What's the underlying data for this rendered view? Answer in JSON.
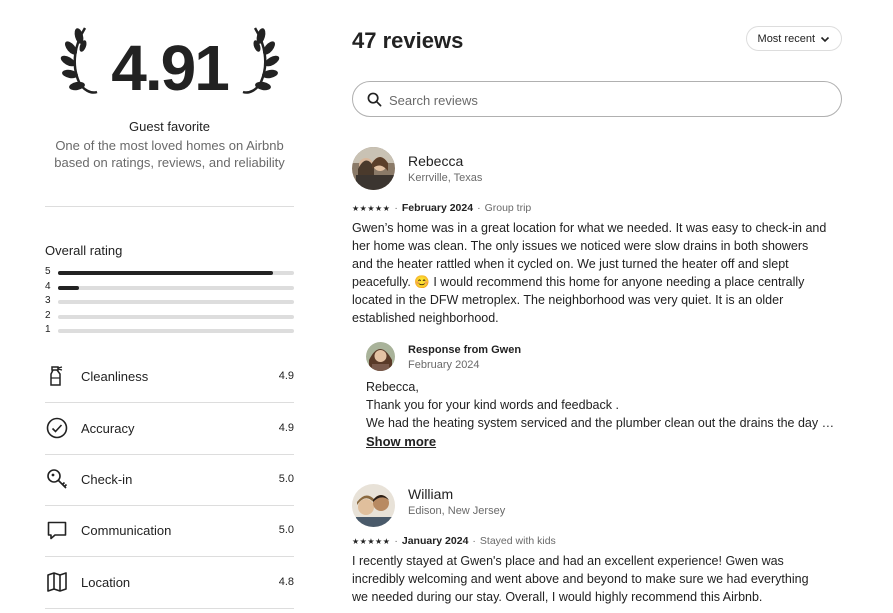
{
  "summary": {
    "rating": "4.91",
    "badge_title": "Guest favorite",
    "badge_subtitle": "One of the most loved homes on Airbnb based on ratings, reviews, and reliability"
  },
  "overall": {
    "title": "Overall rating",
    "bars": [
      {
        "label": "5",
        "fraction": 0.91
      },
      {
        "label": "4",
        "fraction": 0.09
      },
      {
        "label": "3",
        "fraction": 0
      },
      {
        "label": "2",
        "fraction": 0
      },
      {
        "label": "1",
        "fraction": 0
      }
    ]
  },
  "categories": [
    {
      "name": "Cleanliness",
      "value": "4.9",
      "icon": "spray-bottle-icon"
    },
    {
      "name": "Accuracy",
      "value": "4.9",
      "icon": "check-circle-icon"
    },
    {
      "name": "Check-in",
      "value": "5.0",
      "icon": "key-icon"
    },
    {
      "name": "Communication",
      "value": "5.0",
      "icon": "chat-bubble-icon"
    },
    {
      "name": "Location",
      "value": "4.8",
      "icon": "map-icon"
    }
  ],
  "reviews_header": {
    "count_label": "47 reviews",
    "sort_label": "Most recent"
  },
  "search": {
    "placeholder": "Search reviews"
  },
  "reviews": [
    {
      "name": "Rebecca",
      "location": "Kerrville, Texas",
      "stars": "★★★★★",
      "date": "February 2024",
      "trip": "Group trip",
      "lines": [
        "Gwen’s home was in a great location for what we needed. It was easy to check-in and",
        "her home was clean. The only issues we noticed were slow drains in both showers",
        "and the heater rattled when it cycled on. We just turned the heater off and slept",
        "peacefully. 😊 I would recommend this home for anyone needing a place centrally",
        "located in the DFW metroplex. The neighborhood was very quiet. It is an older",
        "established neighborhood."
      ],
      "response": {
        "title": "Response from Gwen",
        "date": "February 2024",
        "lines": [
          "Rebecca,",
          "Thank you for your kind words and feedback .",
          "We had the heating system serviced and the plumber clean out the drains the day after your stay."
        ],
        "show_more": "Show more"
      }
    },
    {
      "name": "William",
      "location": "Edison, New Jersey",
      "stars": "★★★★★",
      "date": "January 2024",
      "trip": "Stayed with kids",
      "lines": [
        "I recently stayed at Gwen's place and had an excellent experience! Gwen was",
        "incredibly welcoming and went above and beyond to make sure we had everything",
        "we needed during our stay. Overall, I would highly recommend this Airbnb."
      ]
    }
  ]
}
